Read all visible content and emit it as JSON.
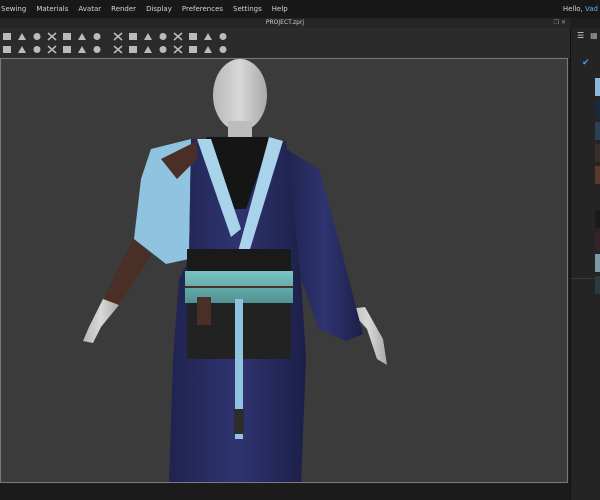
{
  "menu": {
    "items": [
      "Sewing",
      "Materials",
      "Avatar",
      "Render",
      "Display",
      "Preferences",
      "Settings",
      "Help"
    ],
    "greeting": "Hello, ",
    "username": "Vad"
  },
  "title_bar": {
    "title": "PROJECT.zprj",
    "icons": [
      "restore-icon",
      "close-icon"
    ]
  },
  "toolbar": {
    "row1_tools": [
      "fold-tool-icon",
      "select-mesh-icon",
      "transform-pattern-icon",
      "edit-pattern-icon",
      "add-point-icon",
      "polygon-icon",
      "rectangle-icon",
      "internal-polygon-icon",
      "dart-icon",
      "segment-sewing-icon",
      "free-sewing-icon",
      "edit-sewing-icon",
      "tack-icon",
      "pin-icon",
      "measure-icon"
    ],
    "row2_tools": [
      "select-icon",
      "move-icon",
      "fold-arrangement-icon",
      "avatar-icon",
      "simulate-icon",
      "flatten-icon",
      "arrangement-icon",
      "texture-icon",
      "graphic-icon",
      "topstitch-icon",
      "pucker-icon",
      "button-icon",
      "buttonhole-icon",
      "zipper-icon",
      "trim-icon"
    ]
  },
  "right_panel": {
    "tabs": [
      "list-icon",
      "grid-icon"
    ],
    "colors": {
      "accent": "#3ea3ff",
      "swatches": [
        "#8fb9d8",
        "#1a2a3a",
        "#2c3e58",
        "#3a2e2a",
        "#5a3a2a",
        "#232323",
        "#1a1a1a",
        "#3a2028",
        "#7a9aa8",
        "#2a3a45"
      ]
    }
  },
  "viewport": {
    "background": "#3b3b3b",
    "garment_colors": {
      "robe": "#2b2f63",
      "inner": "#8fc3df",
      "sash": "#5fa9a8",
      "belt": "#1c1c1c",
      "sleeve_band": "#4a2f27",
      "skin": "#c9c9c9"
    }
  }
}
